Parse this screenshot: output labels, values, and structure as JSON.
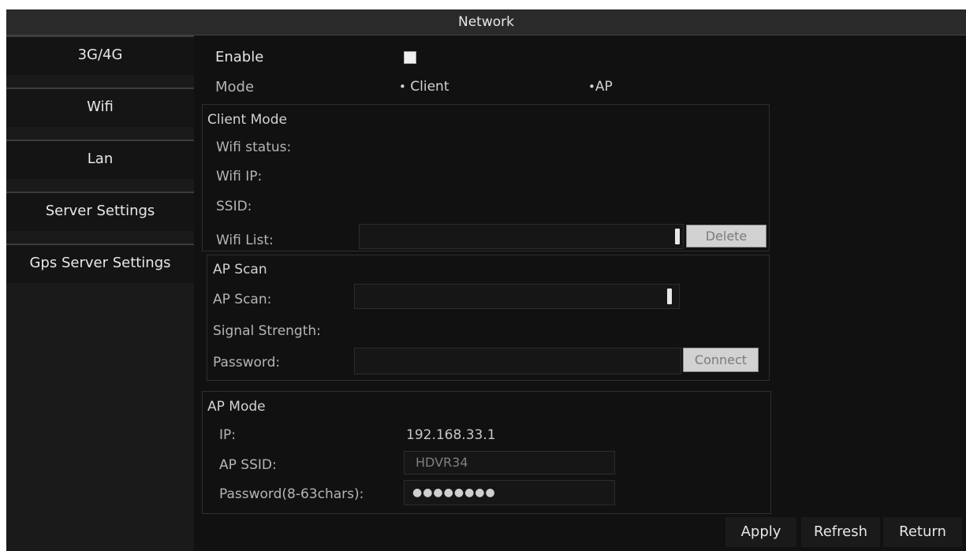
{
  "window": {
    "title": "Network"
  },
  "sidebar": {
    "items": [
      {
        "label": "3G/4G"
      },
      {
        "label": "Wifi"
      },
      {
        "label": "Lan"
      },
      {
        "label": "Server Settings"
      },
      {
        "label": "Gps Server Settings"
      }
    ]
  },
  "general": {
    "enable_label": "Enable",
    "enable_checked": true,
    "mode_label": "Mode",
    "mode_options": [
      "Client",
      "AP"
    ]
  },
  "client_mode": {
    "title": "Client Mode",
    "wifi_status_label": "Wifi status:",
    "wifi_ip_label": "Wifi IP:",
    "ssid_label": "SSID:",
    "wifi_list_label": "Wifi List:",
    "wifi_list_value": "",
    "delete_label": "Delete"
  },
  "ap_scan": {
    "title": "AP Scan",
    "scan_label": "AP Scan:",
    "scan_value": "",
    "signal_label": "Signal Strength:",
    "password_label": "Password:",
    "password_value": "",
    "connect_label": "Connect"
  },
  "ap_mode": {
    "title": "AP Mode",
    "ip_label": "IP:",
    "ip_value": "192.168.33.1",
    "ssid_label": "AP SSID:",
    "ssid_value": "HDVR34",
    "password_label": "Password(8-63chars):",
    "password_value": "●●●●●●●●"
  },
  "footer": {
    "apply_label": "Apply",
    "refresh_label": "Refresh",
    "return_label": "Return"
  }
}
